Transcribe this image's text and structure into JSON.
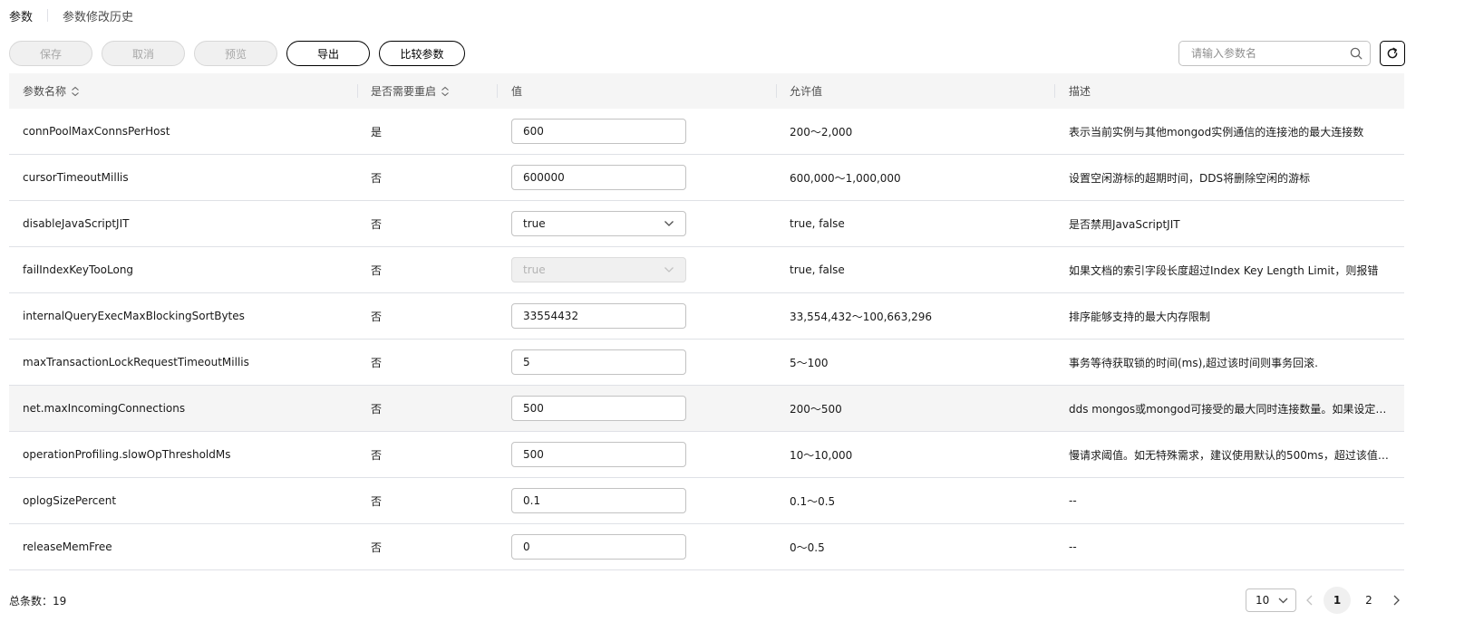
{
  "tabs": [
    {
      "label": "参数",
      "active": true
    },
    {
      "label": "参数修改历史",
      "active": false
    }
  ],
  "toolbar": {
    "save_label": "保存",
    "cancel_label": "取消",
    "preview_label": "预览",
    "export_label": "导出",
    "compare_label": "比较参数"
  },
  "search": {
    "placeholder": "请输入参数名",
    "icon": "search-icon"
  },
  "refresh_icon": "refresh-icon",
  "table": {
    "columns": [
      "参数名称",
      "是否需要重启",
      "值",
      "允许值",
      "描述"
    ],
    "rows": [
      {
        "name": "connPoolMaxConnsPerHost",
        "restart": "是",
        "value": "600",
        "type": "input",
        "allowed": "200～2,000",
        "desc": "表示当前实例与其他mongod实例通信的连接池的最大连接数"
      },
      {
        "name": "cursorTimeoutMillis",
        "restart": "否",
        "value": "600000",
        "type": "input",
        "allowed": "600,000～1,000,000",
        "desc": "设置空闲游标的超期时间，DDS将删除空闲的游标"
      },
      {
        "name": "disableJavaScriptJIT",
        "restart": "否",
        "value": "true",
        "type": "select",
        "allowed": "true, false",
        "desc": "是否禁用JavaScriptJIT"
      },
      {
        "name": "failIndexKeyTooLong",
        "restart": "否",
        "value": "true",
        "type": "select-disabled",
        "allowed": "true, false",
        "desc": "如果文档的索引字段长度超过Index Key Length Limit，则报错"
      },
      {
        "name": "internalQueryExecMaxBlockingSortBytes",
        "restart": "否",
        "value": "33554432",
        "type": "input",
        "allowed": "33,554,432～100,663,296",
        "desc": "排序能够支持的最大内存限制"
      },
      {
        "name": "maxTransactionLockRequestTimeoutMillis",
        "restart": "否",
        "value": "5",
        "type": "input",
        "allowed": "5～100",
        "desc": "事务等待获取锁的时间(ms),超过该时间则事务回滚."
      },
      {
        "name": "net.maxIncomingConnections",
        "restart": "否",
        "value": "500",
        "type": "input",
        "allowed": "200～500",
        "desc": "dds mongos或mongod可接受的最大同时连接数量。如果设定值为..."
      },
      {
        "name": "operationProfiling.slowOpThresholdMs",
        "restart": "否",
        "value": "500",
        "type": "input",
        "allowed": "10～10,000",
        "desc": "慢请求阈值。如无特殊需求，建议使用默认的500ms，超过该值的..."
      },
      {
        "name": "oplogSizePercent",
        "restart": "否",
        "value": "0.1",
        "type": "input",
        "allowed": "0.1～0.5",
        "desc": "--"
      },
      {
        "name": "releaseMemFree",
        "restart": "否",
        "value": "0",
        "type": "input",
        "allowed": "0～0.5",
        "desc": "--"
      }
    ]
  },
  "footer": {
    "total_label": "总条数：19",
    "page_size": "10",
    "pages": [
      "1",
      "2"
    ],
    "current_page": "1"
  }
}
